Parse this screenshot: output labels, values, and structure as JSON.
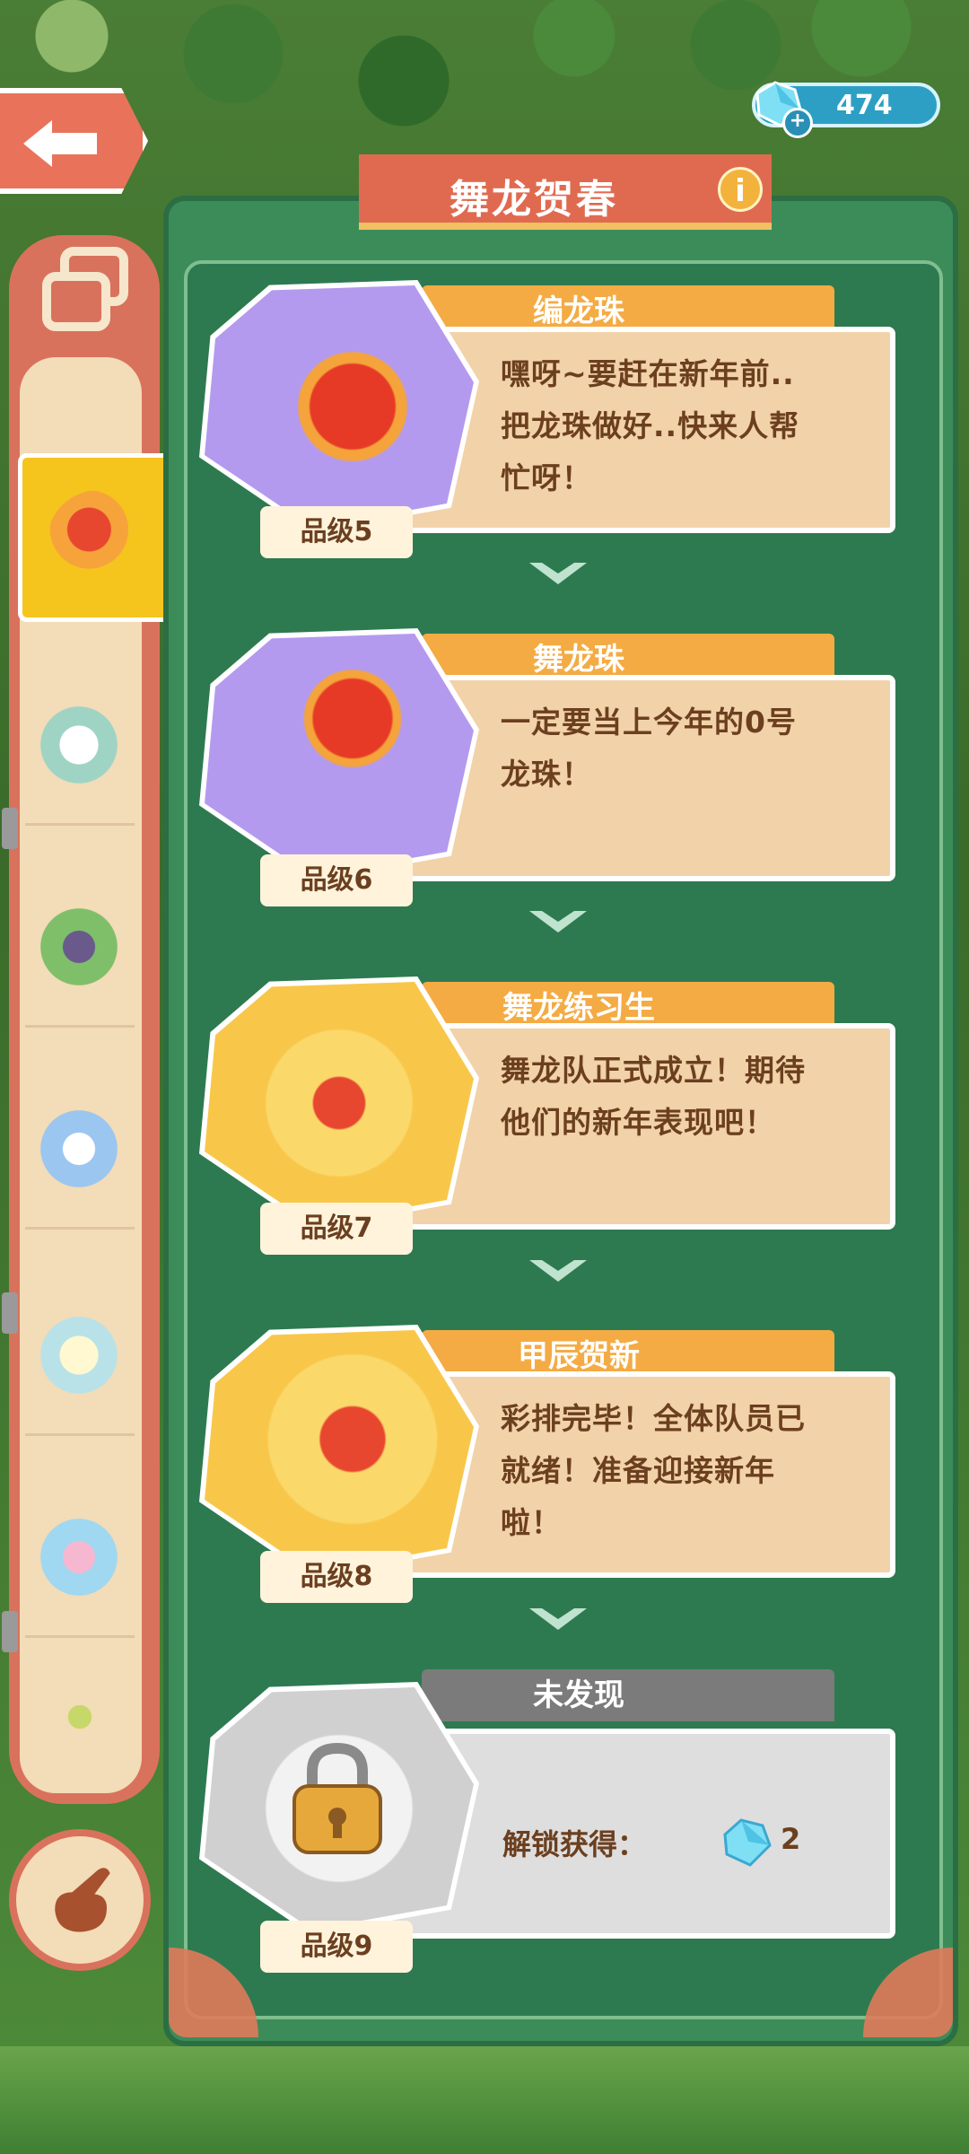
{
  "header": {
    "gem_count": "474",
    "title": "舞龙贺春"
  },
  "cards": [
    {
      "name": "编龙珠",
      "desc1": "嘿呀~要赶在新年前..",
      "desc2": "把龙珠做好..快来人帮",
      "desc3": "忙呀！",
      "grade": "品级5"
    },
    {
      "name": "舞龙珠",
      "desc1": "一定要当上今年的0号",
      "desc2": "龙珠！",
      "grade": "品级6"
    },
    {
      "name": "舞龙练习生",
      "desc1": "舞龙队正式成立！期待",
      "desc2": "他们的新年表现吧！",
      "grade": "品级7"
    },
    {
      "name": "甲辰贺新",
      "desc1": "彩排完毕！全体队员已",
      "desc2": "就绪！准备迎接新年",
      "desc3": "啦！",
      "grade": "品级8"
    },
    {
      "name": "未发现",
      "unlock_label": "解锁获得：",
      "reward": "2",
      "grade": "品级9"
    }
  ],
  "icons": {
    "back": "back-arrow-icon",
    "gem": "diamond-icon",
    "plus": "plus-icon",
    "info": "info-icon",
    "collection": "collection-icon",
    "hand": "pointing-hand-icon",
    "lock": "padlock-icon"
  },
  "colors": {
    "panel": "#3c8c5a",
    "ribbon": "#e06a50",
    "tab": "#f4ab44",
    "card": "#f2d2a8",
    "locked": "#7b7b7b"
  }
}
